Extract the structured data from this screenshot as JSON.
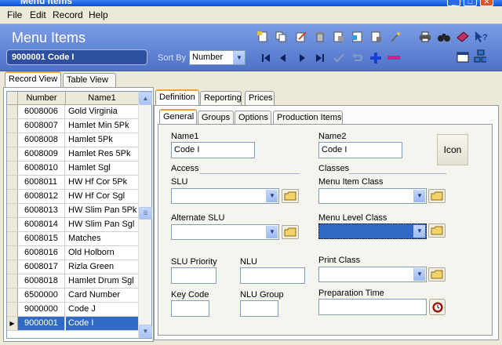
{
  "window": {
    "title": "Menu Items"
  },
  "menu": [
    "File",
    "Edit",
    "Record",
    "Help"
  ],
  "header": {
    "title": "Menu Items",
    "record": "9000001  Code I",
    "sort_by_label": "Sort By",
    "sort_by_value": "Number"
  },
  "view_tabs": [
    "Record View",
    "Table View"
  ],
  "grid": {
    "columns": [
      "Number",
      "Name1"
    ],
    "rows": [
      {
        "number": "6008006",
        "name": "Gold Virginia"
      },
      {
        "number": "6008007",
        "name": "Hamlet Min 5Pk"
      },
      {
        "number": "6008008",
        "name": "Hamlet 5Pk"
      },
      {
        "number": "6008009",
        "name": "Hamlet Res 5Pk"
      },
      {
        "number": "6008010",
        "name": "Hamlet Sgl"
      },
      {
        "number": "6008011",
        "name": "HW Hf Cor 5Pk"
      },
      {
        "number": "6008012",
        "name": "HW Hf Cor Sgl"
      },
      {
        "number": "6008013",
        "name": "HW Slim Pan 5Pk"
      },
      {
        "number": "6008014",
        "name": "HW Slim Pan Sgl"
      },
      {
        "number": "6008015",
        "name": "Matches"
      },
      {
        "number": "6008016",
        "name": "Old Holborn"
      },
      {
        "number": "6008017",
        "name": "Rizla Green"
      },
      {
        "number": "6008018",
        "name": "Hamlet Drum Sgl"
      },
      {
        "number": "6500000",
        "name": "Card Number"
      },
      {
        "number": "9000000",
        "name": "Code J"
      },
      {
        "number": "9000001",
        "name": "Code I"
      }
    ]
  },
  "detail_tabs": [
    "Definition",
    "Reporting",
    "Prices"
  ],
  "sub_tabs": [
    "General",
    "Groups",
    "Options",
    "Production Items"
  ],
  "form": {
    "name1_label": "Name1",
    "name1_value": "Code I",
    "name2_label": "Name2",
    "name2_value": "Code I",
    "icon_label": "Icon",
    "access_label": "Access",
    "classes_label": "Classes",
    "slu_label": "SLU",
    "menu_item_class_label": "Menu Item Class",
    "alt_slu_label": "Alternate SLU",
    "menu_level_class_label": "Menu Level Class",
    "slu_priority_label": "SLU Priority",
    "nlu_label": "NLU",
    "print_class_label": "Print Class",
    "key_code_label": "Key Code",
    "nlu_group_label": "NLU Group",
    "prep_time_label": "Preparation Time"
  }
}
